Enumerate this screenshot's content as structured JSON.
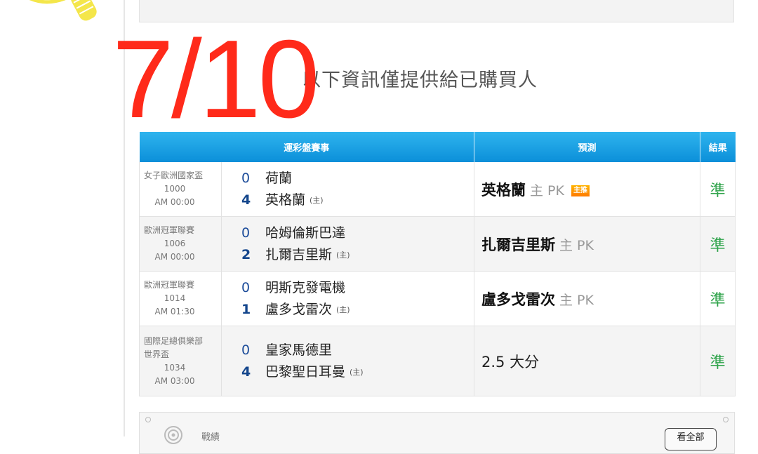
{
  "overlay_text": "7/10",
  "section_title": "以下資訊僅提供給已購買人",
  "table": {
    "headers": [
      "運彩盤賽事",
      "預測",
      "結果"
    ],
    "rows": [
      {
        "league": "女子歐洲國家盃",
        "game_no": "1000",
        "time": "AM 00:00",
        "away_score": "0",
        "away_team": "荷蘭",
        "home_score": "4",
        "home_team": "英格蘭",
        "home_mark": "(主)",
        "pred_team": "英格蘭",
        "pred_detail": "主 PK",
        "pred_badge": "主推",
        "result": "準"
      },
      {
        "league": "歐洲冠軍聯賽",
        "game_no": "1006",
        "time": "AM 00:00",
        "away_score": "0",
        "away_team": "哈姆倫斯巴達",
        "home_score": "2",
        "home_team": "扎爾吉里斯",
        "home_mark": "(主)",
        "pred_team": "扎爾吉里斯",
        "pred_detail": "主 PK",
        "result": "準"
      },
      {
        "league": "歐洲冠軍聯賽",
        "game_no": "1014",
        "time": "AM 01:30",
        "away_score": "0",
        "away_team": "明斯克發電機",
        "home_score": "1",
        "home_team": "盧多戈雷次",
        "home_mark": "(主)",
        "pred_team": "盧多戈雷次",
        "pred_detail": "主 PK",
        "result": "準"
      },
      {
        "league_line1": "國際足總俱樂部",
        "league_line2": "世界盃",
        "game_no": "1034",
        "time": "AM 03:00",
        "away_score": "0",
        "away_team": "皇家馬德里",
        "home_score": "4",
        "home_team": "巴黎聖日耳曼",
        "home_mark": "(主)",
        "pred_plain": "2.5 大分",
        "result": "準"
      }
    ]
  },
  "bottom_panel": {
    "label": "戰績",
    "button": "看全部"
  },
  "colors": {
    "header_blue": "#0b8fd9",
    "result_green": "#2ea34a",
    "overlay_red": "#ff2a1a"
  },
  "icons": [
    "lightbulb-icon",
    "record-icon"
  ]
}
